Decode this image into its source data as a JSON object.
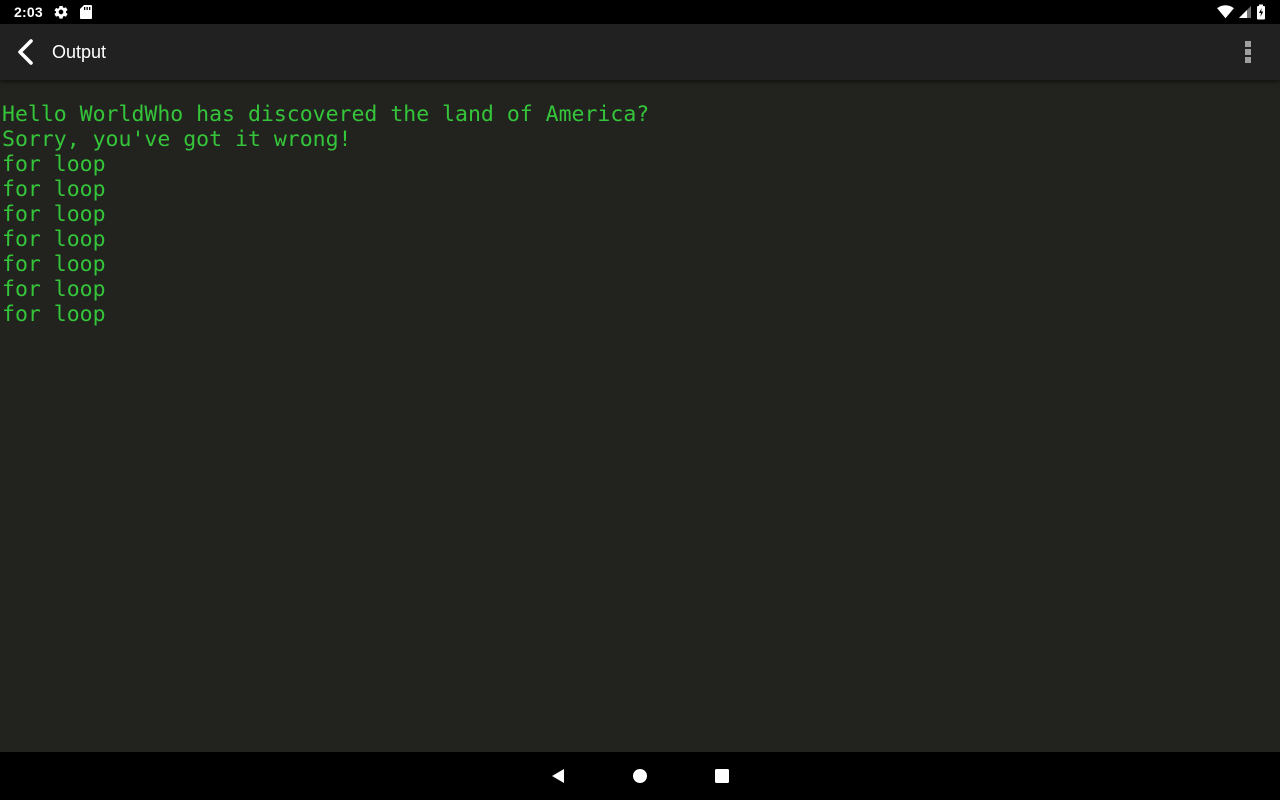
{
  "status_bar": {
    "time": "2:03",
    "icons": [
      "settings-gear-icon",
      "sd-card-icon",
      "wifi-icon",
      "cell-signal-icon",
      "battery-icon"
    ]
  },
  "app_bar": {
    "title": "Output",
    "back_icon": "chevron-left-icon",
    "menu_icon": "more-vertical-icon"
  },
  "output": {
    "lines": [
      "Hello WorldWho has discovered the land of America?",
      "Sorry, you've got it wrong!",
      "for loop",
      "for loop",
      "for loop",
      "for loop",
      "for loop",
      "for loop",
      "for loop"
    ]
  },
  "nav_bar": {
    "buttons": [
      "back-triangle-icon",
      "home-circle-icon",
      "recents-square-icon"
    ]
  },
  "colors": {
    "output_text": "#35c53a",
    "background": "#22231f",
    "app_bar": "#212121"
  }
}
